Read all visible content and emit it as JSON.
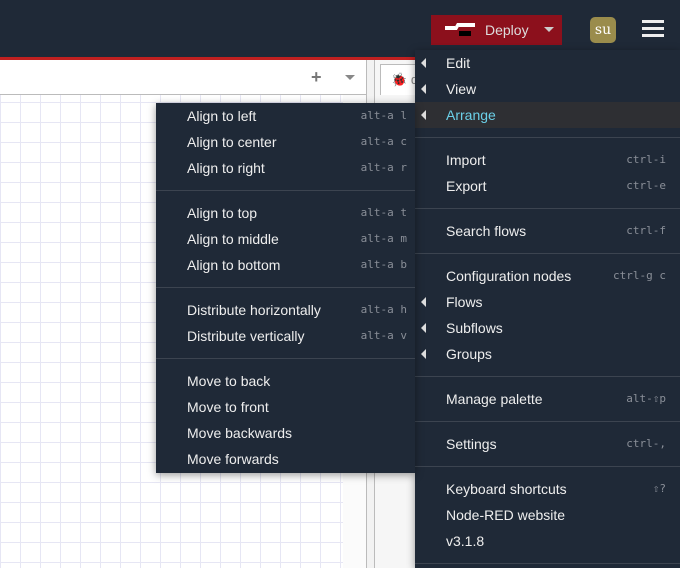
{
  "header": {
    "deploy_label": "Deploy",
    "user_initials": "su",
    "accent": "#8c101c"
  },
  "sidebar": {
    "tab_label": "d"
  },
  "main_menu": {
    "items": [
      {
        "label": "Edit",
        "shortcut": "",
        "submenu": true
      },
      {
        "label": "View",
        "shortcut": "",
        "submenu": true
      },
      {
        "label": "Arrange",
        "shortcut": "",
        "submenu": true,
        "highlighted": true
      },
      {
        "label": "Import",
        "shortcut": "ctrl-i"
      },
      {
        "label": "Export",
        "shortcut": "ctrl-e"
      },
      {
        "label": "Search flows",
        "shortcut": "ctrl-f"
      },
      {
        "label": "Configuration nodes",
        "shortcut": "ctrl-g c"
      },
      {
        "label": "Flows",
        "shortcut": "",
        "submenu": true
      },
      {
        "label": "Subflows",
        "shortcut": "",
        "submenu": true
      },
      {
        "label": "Groups",
        "shortcut": "",
        "submenu": true
      },
      {
        "label": "Manage palette",
        "shortcut": "alt-⇧p"
      },
      {
        "label": "Settings",
        "shortcut": "ctrl-,"
      },
      {
        "label": "Keyboard shortcuts",
        "shortcut": "⇧?"
      },
      {
        "label": "Node-RED website",
        "shortcut": ""
      },
      {
        "label": "v3.1.8",
        "shortcut": ""
      }
    ]
  },
  "arrange_menu": {
    "items": [
      {
        "label": "Align to left",
        "shortcut": "alt-a l"
      },
      {
        "label": "Align to center",
        "shortcut": "alt-a c"
      },
      {
        "label": "Align to right",
        "shortcut": "alt-a r"
      },
      {
        "label": "Align to top",
        "shortcut": "alt-a t"
      },
      {
        "label": "Align to middle",
        "shortcut": "alt-a m"
      },
      {
        "label": "Align to bottom",
        "shortcut": "alt-a b"
      },
      {
        "label": "Distribute horizontally",
        "shortcut": "alt-a h"
      },
      {
        "label": "Distribute vertically",
        "shortcut": "alt-a v"
      },
      {
        "label": "Move to back",
        "shortcut": ""
      },
      {
        "label": "Move to front",
        "shortcut": ""
      },
      {
        "label": "Move backwards",
        "shortcut": ""
      },
      {
        "label": "Move forwards",
        "shortcut": ""
      }
    ]
  }
}
